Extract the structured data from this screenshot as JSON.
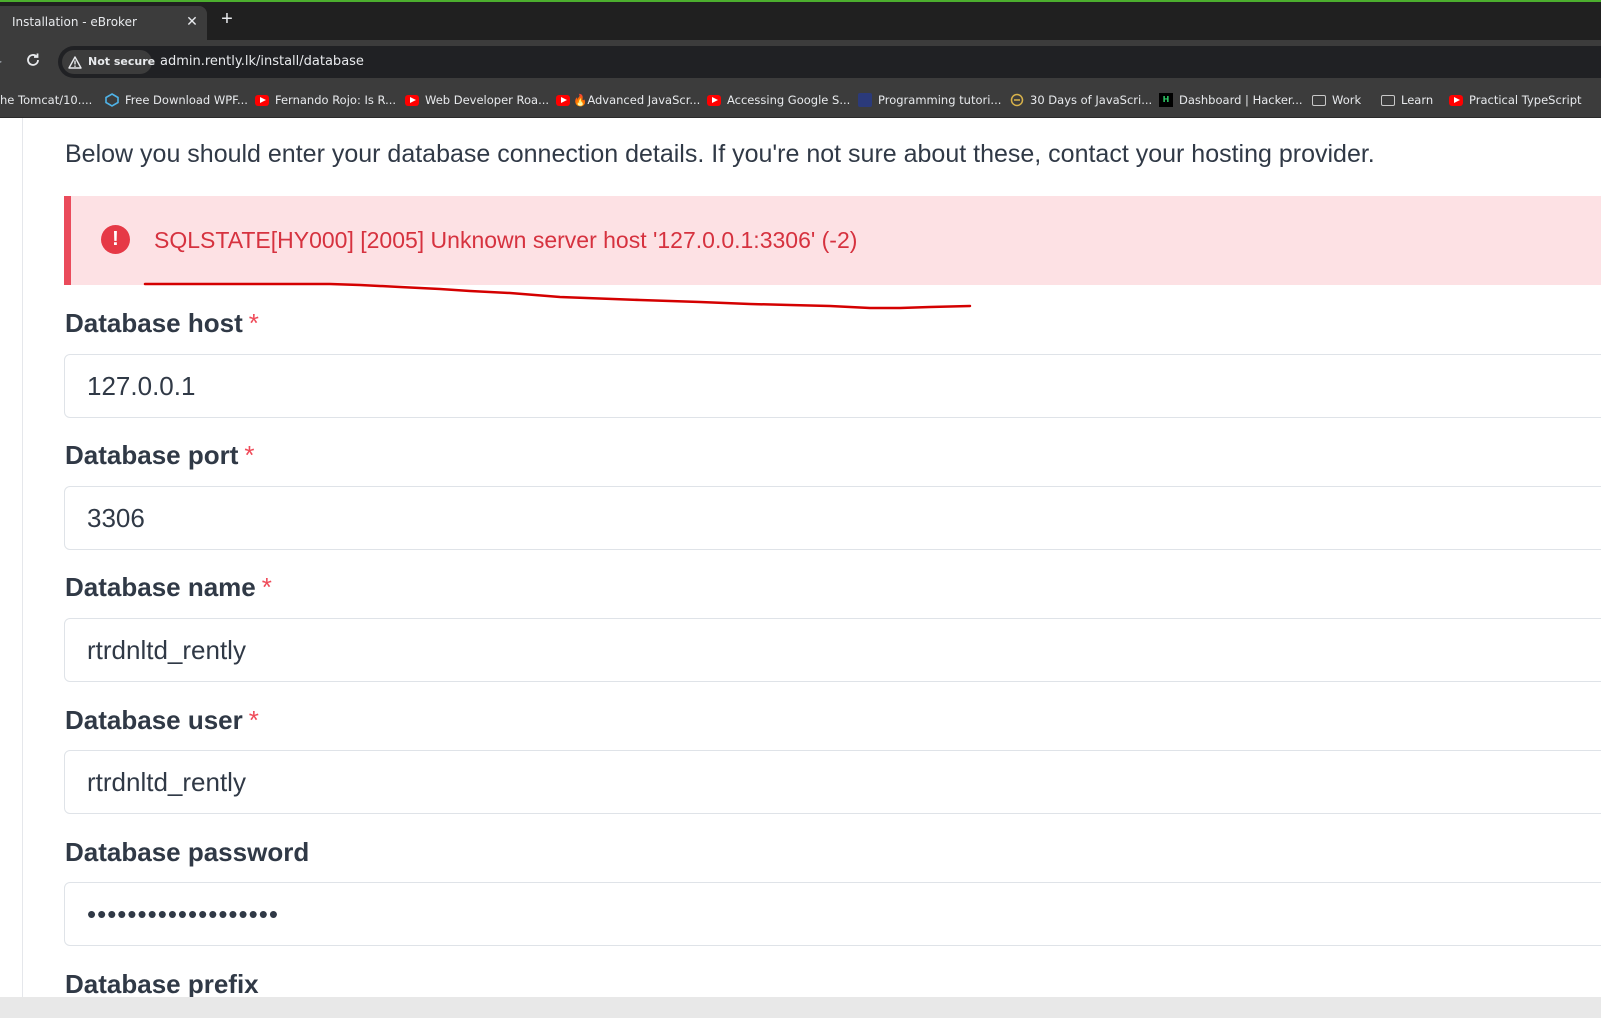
{
  "browser": {
    "accent_color": "#4caf2e",
    "tab": {
      "title": "Installation - eBroker",
      "close_label": "✕"
    },
    "new_tab_label": "+",
    "security_label": "Not secure",
    "url": "admin.rently.lk/install/database",
    "bookmarks": [
      {
        "label": "he Tomcat/10....",
        "icon": "none"
      },
      {
        "label": "Free Download WPF...",
        "icon": "wpf-icon"
      },
      {
        "label": "Fernando Rojo: Is R...",
        "icon": "youtube-icon"
      },
      {
        "label": "Web Developer Roa...",
        "icon": "youtube-icon"
      },
      {
        "label": "🔥Advanced JavaScr...",
        "icon": "youtube-icon"
      },
      {
        "label": "Accessing Google S...",
        "icon": "youtube-icon"
      },
      {
        "label": "Programming tutori...",
        "icon": "site-icon"
      },
      {
        "label": "30 Days of JavaScri...",
        "icon": "site-icon"
      },
      {
        "label": "Dashboard | Hacker...",
        "icon": "hackerrank-icon"
      },
      {
        "label": "Work",
        "icon": "folder-icon"
      },
      {
        "label": "Learn",
        "icon": "folder-icon"
      },
      {
        "label": "Practical TypeScript",
        "icon": "youtube-icon"
      }
    ]
  },
  "page": {
    "intro": "Below you should enter your database connection details. If you're not sure about these, contact your hosting provider.",
    "alert": {
      "icon": "exclamation-circle-icon",
      "icon_glyph": "!",
      "message": "SQLSTATE[HY000] [2005] Unknown server host '127.0.0.1:3306' (-2)"
    },
    "required_marker": "*",
    "fields": {
      "host": {
        "label": "Database host",
        "value": "127.0.0.1"
      },
      "port": {
        "label": "Database port",
        "value": "3306"
      },
      "name": {
        "label": "Database name",
        "value": "rtrdnltd_rently"
      },
      "user": {
        "label": "Database user",
        "value": "rtrdnltd_rently"
      },
      "password": {
        "label": "Database password",
        "masked_value": "•••••••••••••••••••"
      },
      "prefix": {
        "label": "Database prefix"
      }
    }
  }
}
